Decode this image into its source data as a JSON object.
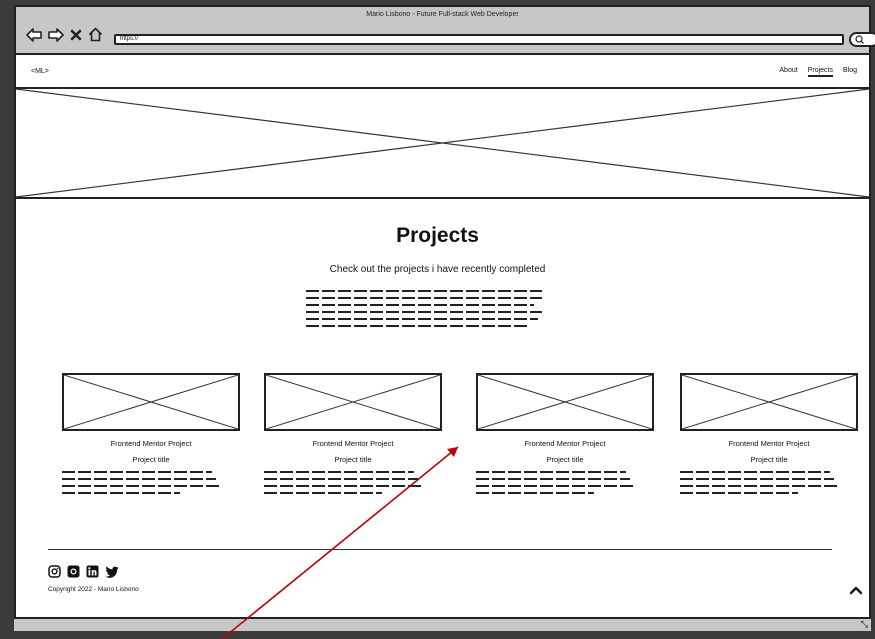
{
  "window": {
    "title": "Mario Lisbono - Future Full-stack Web Developer"
  },
  "browser": {
    "url": "https://"
  },
  "nav": {
    "logo": "<ML>",
    "links": [
      "About",
      "Projects",
      "Blog"
    ],
    "active": "Projects"
  },
  "main": {
    "title": "Projects",
    "subtitle": "Check out the projects i have recently completed"
  },
  "projects": [
    {
      "name": "Frontend Mentor Project",
      "subtitle": "Project title"
    },
    {
      "name": "Frontend Mentor Project",
      "subtitle": "Project title"
    },
    {
      "name": "Frontend Mentor Project",
      "subtitle": "Project title"
    },
    {
      "name": "Frontend Mentor Project",
      "subtitle": "Project title"
    }
  ],
  "footer": {
    "social_icons": [
      "instagram-icon",
      "github-icon",
      "linkedin-icon",
      "twitter-icon"
    ],
    "copyright": "Copyright 2022 - Mario Lisbono"
  },
  "colors": {
    "chrome": "#c7c7c7",
    "annotation_arrow": "#c00000",
    "outer_background": "#3b3b3b"
  }
}
